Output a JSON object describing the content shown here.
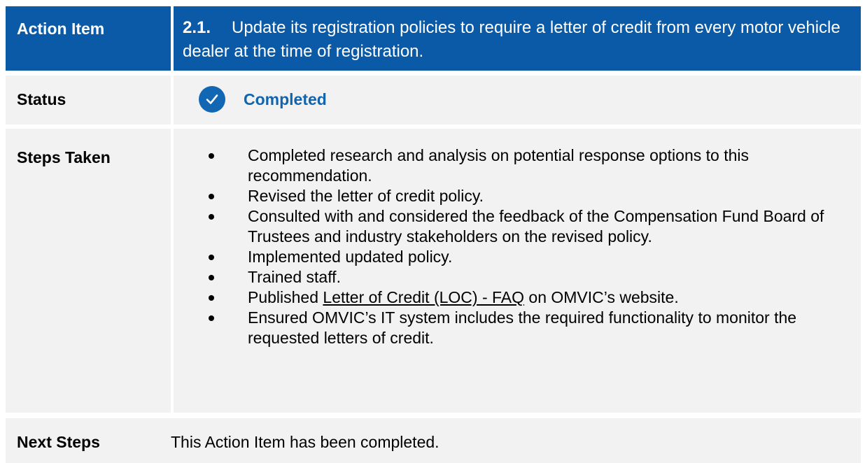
{
  "action_item": {
    "label": "Action Item",
    "number": "2.1.",
    "text": "Update its registration policies to require a letter of credit from every motor vehicle dealer at the time of registration."
  },
  "status": {
    "label": "Status",
    "value": "Completed",
    "icon": "check-circle-icon",
    "color": "#1164b0"
  },
  "steps_taken": {
    "label": "Steps Taken",
    "items": [
      {
        "text": "Completed research and analysis on potential response options to this recommendation."
      },
      {
        "text": "Revised the letter of credit policy."
      },
      {
        "text": "Consulted with and considered the feedback of the Compensation Fund Board of Trustees and industry stakeholders on the revised policy."
      },
      {
        "text": "Implemented updated policy."
      },
      {
        "text": "Trained staff."
      },
      {
        "prefix": "Published ",
        "link": "Letter of Credit (LOC) - FAQ",
        "suffix": " on OMVIC’s website."
      },
      {
        "text": "Ensured OMVIC’s IT system includes the required functionality to monitor the requested letters of credit."
      }
    ]
  },
  "next_steps": {
    "label": "Next Steps",
    "text": "This Action Item has been completed."
  },
  "colors": {
    "header_blue": "#0b5aa7",
    "row_gray": "#f2f2f2"
  }
}
